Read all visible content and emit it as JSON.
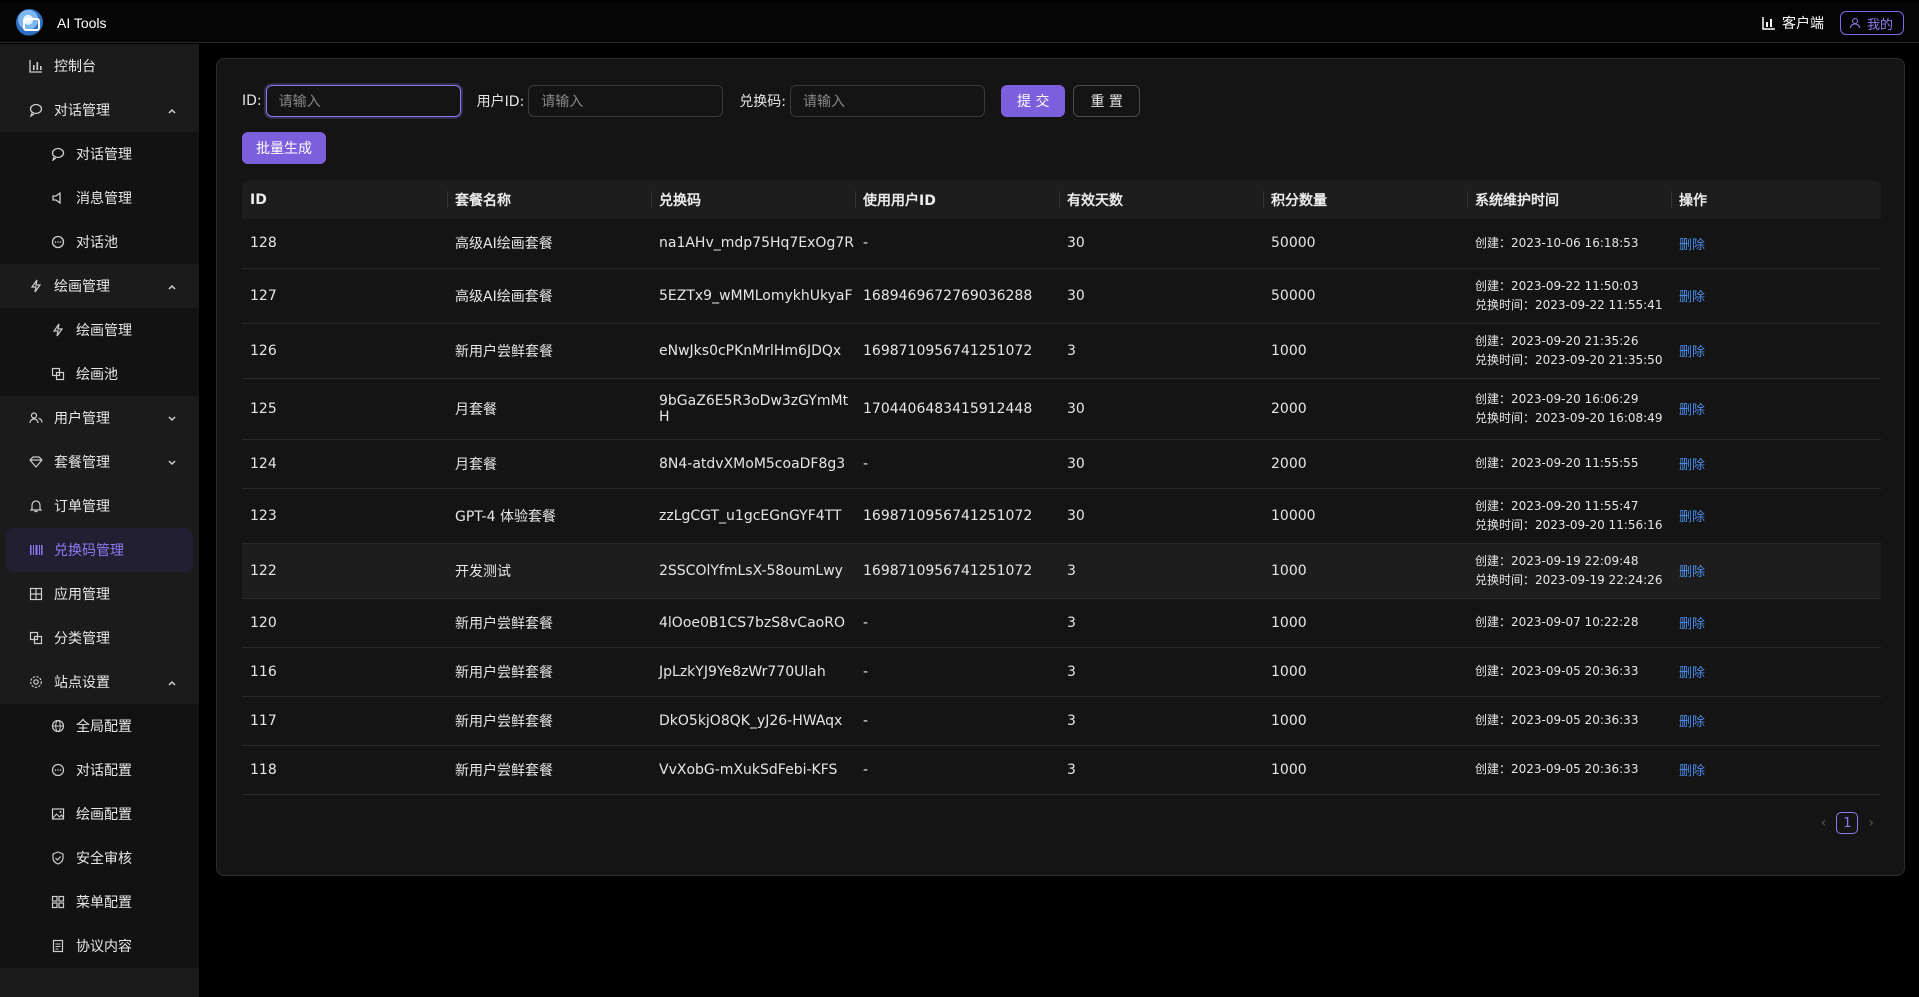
{
  "app": {
    "title": "AI Tools"
  },
  "header": {
    "client_label": "客户端",
    "mine_label": "我的"
  },
  "sidebar": {
    "items": [
      {
        "label": "控制台",
        "icon": "bar-chart-icon"
      },
      {
        "label": "对话管理",
        "icon": "chat-icon",
        "expanded": true,
        "children": [
          {
            "label": "对话管理",
            "icon": "chat-icon"
          },
          {
            "label": "消息管理",
            "icon": "speaker-icon"
          },
          {
            "label": "对话池",
            "icon": "chat-dots-icon"
          }
        ]
      },
      {
        "label": "绘画管理",
        "icon": "lightning-icon",
        "expanded": true,
        "children": [
          {
            "label": "绘画管理",
            "icon": "lightning-icon"
          },
          {
            "label": "绘画池",
            "icon": "layers-icon"
          }
        ]
      },
      {
        "label": "用户管理",
        "icon": "users-icon",
        "expanded": false
      },
      {
        "label": "套餐管理",
        "icon": "diamond-icon",
        "expanded": false
      },
      {
        "label": "订单管理",
        "icon": "bell-icon"
      },
      {
        "label": "兑换码管理",
        "icon": "barcode-icon",
        "active": true
      },
      {
        "label": "应用管理",
        "icon": "grid-icon"
      },
      {
        "label": "分类管理",
        "icon": "copy-icon"
      },
      {
        "label": "站点设置",
        "icon": "gear-icon",
        "expanded": true,
        "children": [
          {
            "label": "全局配置",
            "icon": "globe-icon"
          },
          {
            "label": "对话配置",
            "icon": "chat-dots-icon"
          },
          {
            "label": "绘画配置",
            "icon": "image-icon"
          },
          {
            "label": "安全审核",
            "icon": "shield-icon"
          },
          {
            "label": "菜单配置",
            "icon": "grid-icon"
          },
          {
            "label": "协议内容",
            "icon": "document-icon"
          }
        ]
      }
    ]
  },
  "filters": {
    "id_label": "ID:",
    "id_placeholder": "请输入",
    "user_id_label": "用户ID:",
    "user_id_placeholder": "请输入",
    "code_label": "兑换码:",
    "code_placeholder": "请输入",
    "submit_label": "提 交",
    "reset_label": "重 置"
  },
  "batch_button": "批量生成",
  "table": {
    "columns": [
      "ID",
      "套餐名称",
      "兑换码",
      "使用用户ID",
      "有效天数",
      "积分数量",
      "系统维护时间",
      "操作"
    ],
    "rows": [
      {
        "id": "128",
        "name": "高级AI绘画套餐",
        "code": "na1AHv_mdp75Hq7ExOg7R",
        "user": "-",
        "days": "30",
        "points": "50000",
        "time1": "创建：2023-10-06 16:18:53",
        "time2": "",
        "action": "删除"
      },
      {
        "id": "127",
        "name": "高级AI绘画套餐",
        "code": "5EZTx9_wMMLomykhUkyaF",
        "user": "1689469672769036288",
        "days": "30",
        "points": "50000",
        "time1": "创建：2023-09-22 11:50:03",
        "time2": "兑换时间：2023-09-22 11:55:41",
        "action": "删除"
      },
      {
        "id": "126",
        "name": "新用户尝鲜套餐",
        "code": "eNwJks0cPKnMrlHm6JDQx",
        "user": "1698710956741251072",
        "days": "3",
        "points": "1000",
        "time1": "创建：2023-09-20 21:35:26",
        "time2": "兑换时间：2023-09-20 21:35:50",
        "action": "删除"
      },
      {
        "id": "125",
        "name": "月套餐",
        "code": "9bGaZ6E5R3oDw3zGYmMtH",
        "user": "1704406483415912448",
        "days": "30",
        "points": "2000",
        "time1": "创建：2023-09-20 16:06:29",
        "time2": "兑换时间：2023-09-20 16:08:49",
        "action": "删除"
      },
      {
        "id": "124",
        "name": "月套餐",
        "code": "8N4-atdvXMoM5coaDF8g3",
        "user": "-",
        "days": "30",
        "points": "2000",
        "time1": "创建：2023-09-20 11:55:55",
        "time2": "",
        "action": "删除"
      },
      {
        "id": "123",
        "name": "GPT-4 体验套餐",
        "code": "zzLgCGT_u1gcEGnGYF4TT",
        "user": "1698710956741251072",
        "days": "30",
        "points": "10000",
        "time1": "创建：2023-09-20 11:55:47",
        "time2": "兑换时间：2023-09-20 11:56:16",
        "action": "删除"
      },
      {
        "id": "122",
        "name": "开发测试",
        "code": "2SSCOlYfmLsX-58oumLwy",
        "user": "1698710956741251072",
        "days": "3",
        "points": "1000",
        "time1": "创建：2023-09-19 22:09:48",
        "time2": "兑换时间：2023-09-19 22:24:26",
        "action": "删除"
      },
      {
        "id": "120",
        "name": "新用户尝鲜套餐",
        "code": "4lOoe0B1CS7bzS8vCaoRO",
        "user": "-",
        "days": "3",
        "points": "1000",
        "time1": "创建：2023-09-07 10:22:28",
        "time2": "",
        "action": "删除"
      },
      {
        "id": "116",
        "name": "新用户尝鲜套餐",
        "code": "JpLzkYJ9Ye8zWr770Ulah",
        "user": "-",
        "days": "3",
        "points": "1000",
        "time1": "创建：2023-09-05 20:36:33",
        "time2": "",
        "action": "删除"
      },
      {
        "id": "117",
        "name": "新用户尝鲜套餐",
        "code": "DkO5kjO8QK_yJ26-HWAqx",
        "user": "-",
        "days": "3",
        "points": "1000",
        "time1": "创建：2023-09-05 20:36:33",
        "time2": "",
        "action": "删除"
      },
      {
        "id": "118",
        "name": "新用户尝鲜套餐",
        "code": "VvXobG-mXukSdFebi-KFS",
        "user": "-",
        "days": "3",
        "points": "1000",
        "time1": "创建：2023-09-05 20:36:33",
        "time2": "",
        "action": "删除"
      }
    ]
  },
  "pagination": {
    "current_page": "1",
    "prev": "‹",
    "next": "›"
  },
  "colors": {
    "accent": "#7b5fdd",
    "link": "#4a8ef0",
    "background": "#000000"
  }
}
